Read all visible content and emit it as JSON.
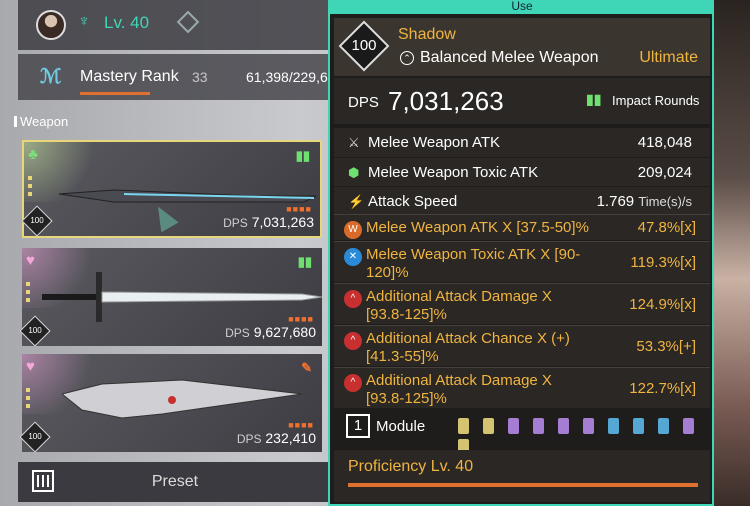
{
  "player": {
    "level_label": "Lv. 40"
  },
  "mastery": {
    "label": "Mastery Rank",
    "rank": "33",
    "xp": "61,398/229,6"
  },
  "weapon_section": {
    "label": "Weapon"
  },
  "weapons": [
    {
      "suit": "♣",
      "suit_color": "#7be07b",
      "badge": "100",
      "dps_label": "DPS",
      "dps": "7,031,263",
      "selected": true
    },
    {
      "suit": "♥",
      "suit_color": "#f4a8d8",
      "badge": "100",
      "dps_label": "DPS",
      "dps": "9,627,680",
      "selected": false
    },
    {
      "suit": "♥",
      "suit_color": "#f4a8d8",
      "badge": "100",
      "dps_label": "DPS",
      "dps": "232,410",
      "selected": false
    }
  ],
  "preset": {
    "label": "Preset"
  },
  "popup": {
    "use_label": "Use",
    "level": "100",
    "name": "Shadow",
    "type": "Balanced Melee Weapon",
    "grade": "Ultimate",
    "dps_label": "DPS",
    "dps": "7,031,263",
    "ammo": "Impact Rounds",
    "stats": [
      {
        "icon": "sword-icon",
        "label": "Melee Weapon ATK",
        "value": "418,048",
        "unit": ""
      },
      {
        "icon": "toxic-icon",
        "label": "Melee Weapon Toxic ATK",
        "value": "209,024",
        "unit": ""
      },
      {
        "icon": "speed-icon",
        "label": "Attack Speed",
        "value": "1.769",
        "unit": "Time(s)/s"
      }
    ],
    "substats": [
      {
        "icon_color": "#d86a2a",
        "label": "Melee Weapon ATK X [37.5-50]%",
        "value": "47.8%[x]"
      },
      {
        "icon_color": "#2a8ad8",
        "label": "Melee Weapon Toxic ATK X [90-120]%",
        "value": "119.3%[x]"
      },
      {
        "icon_color": "#c83030",
        "label": "Additional Attack Damage X [93.8-125]%",
        "value": "124.9%[x]"
      },
      {
        "icon_color": "#c83030",
        "label": "Additional Attack Chance X (+) [41.3-55]%",
        "value": "53.3%[+]"
      },
      {
        "icon_color": "#c83030",
        "label": "Additional Attack Damage X [93.8-125]%",
        "value": "122.7%[x]"
      }
    ],
    "module_count": "1",
    "module_label": "Module",
    "module_slots": [
      "#e8d67a",
      "#e8d67a",
      "#b48ae8",
      "#b48ae8",
      "#b48ae8",
      "#b48ae8",
      "#5ab8e8",
      "#5ab8e8",
      "#5ab8e8",
      "#b48ae8",
      "#e8d67a"
    ],
    "proficiency": "Proficiency Lv. 40"
  }
}
